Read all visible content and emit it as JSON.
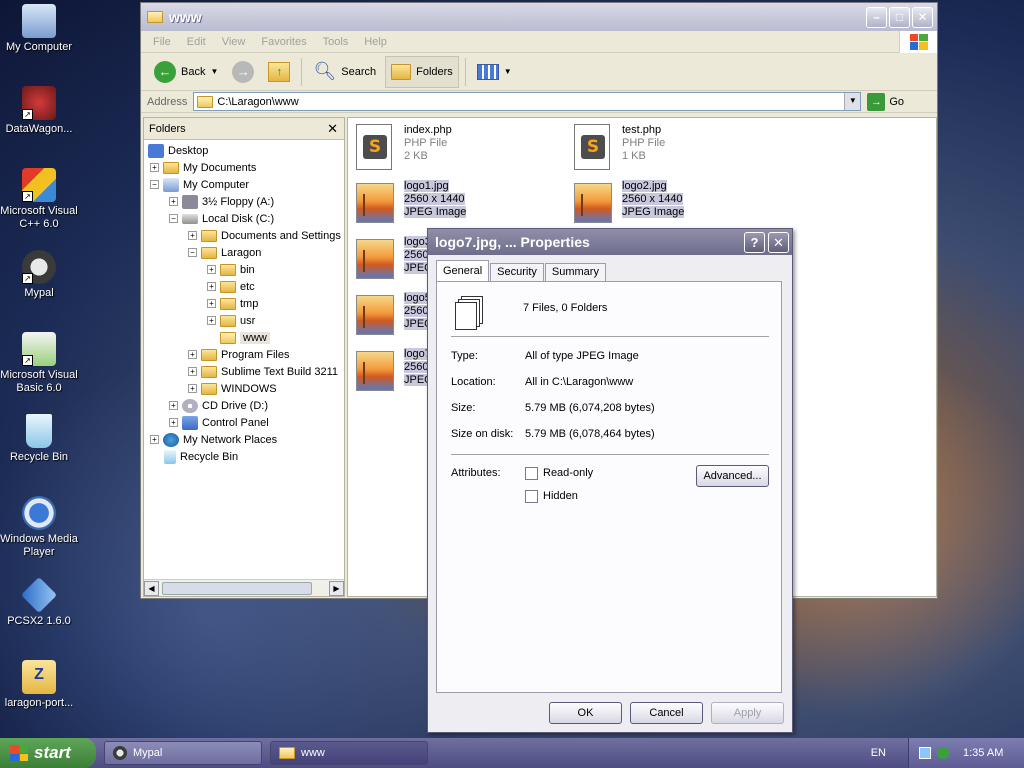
{
  "desktop": {
    "icons": [
      {
        "label": "My Computer"
      },
      {
        "label": "DataWagon..."
      },
      {
        "label": "Microsoft Visual C++ 6.0"
      },
      {
        "label": "Mypal"
      },
      {
        "label": "Microsoft Visual Basic 6.0"
      },
      {
        "label": "Recycle Bin"
      },
      {
        "label": "Windows Media Player"
      },
      {
        "label": "PCSX2 1.6.0"
      },
      {
        "label": "laragon-port..."
      }
    ]
  },
  "explorer": {
    "title": "www",
    "menu": [
      "File",
      "Edit",
      "View",
      "Favorites",
      "Tools",
      "Help"
    ],
    "toolbar": {
      "back": "Back",
      "search": "Search",
      "folders": "Folders"
    },
    "address": {
      "label": "Address",
      "value": "C:\\Laragon\\www",
      "go": "Go"
    },
    "folders_pane": {
      "title": "Folders",
      "items": [
        {
          "label": "Desktop"
        },
        {
          "label": "My Documents"
        },
        {
          "label": "My Computer"
        },
        {
          "label": "3½ Floppy (A:)"
        },
        {
          "label": "Local Disk (C:)"
        },
        {
          "label": "Documents and Settings"
        },
        {
          "label": "Laragon"
        },
        {
          "label": "bin"
        },
        {
          "label": "etc"
        },
        {
          "label": "tmp"
        },
        {
          "label": "usr"
        },
        {
          "label": "www"
        },
        {
          "label": "Program Files"
        },
        {
          "label": "Sublime Text Build 3211"
        },
        {
          "label": "WINDOWS"
        },
        {
          "label": "CD Drive (D:)"
        },
        {
          "label": "Control Panel"
        },
        {
          "label": "My Network Places"
        },
        {
          "label": "Recycle Bin"
        }
      ]
    },
    "files": [
      {
        "name": "index.php",
        "type": "PHP File",
        "size": "2 KB"
      },
      {
        "name": "test.php",
        "type": "PHP File",
        "size": "1 KB"
      },
      {
        "name": "logo1.jpg",
        "dims": "2560 x 1440",
        "type": "JPEG Image"
      },
      {
        "name": "logo2.jpg",
        "dims": "2560 x 1440",
        "type": "JPEG Image"
      },
      {
        "name": "logo3",
        "dims": "2560",
        "type": "JPEG"
      },
      {
        "name": "logo5",
        "dims": "2560",
        "type": "JPEG"
      },
      {
        "name": "logo7",
        "dims": "2560",
        "type": "JPEG"
      }
    ]
  },
  "properties": {
    "title": "logo7.jpg, ... Properties",
    "tabs": [
      "General",
      "Security",
      "Summary"
    ],
    "summary": "7 Files, 0 Folders",
    "type_label": "Type:",
    "type_value": "All of type JPEG Image",
    "location_label": "Location:",
    "location_value": "All in C:\\Laragon\\www",
    "size_label": "Size:",
    "size_value": "5.79 MB (6,074,208 bytes)",
    "disk_label": "Size on disk:",
    "disk_value": "5.79 MB (6,078,464 bytes)",
    "attributes_label": "Attributes:",
    "readonly_label": "Read-only",
    "hidden_label": "Hidden",
    "advanced_label": "Advanced...",
    "ok_label": "OK",
    "cancel_label": "Cancel",
    "apply_label": "Apply"
  },
  "taskbar": {
    "start": "start",
    "tasks": [
      {
        "label": "Mypal"
      },
      {
        "label": "www"
      }
    ],
    "lang": "EN",
    "clock": "1:35 AM"
  }
}
